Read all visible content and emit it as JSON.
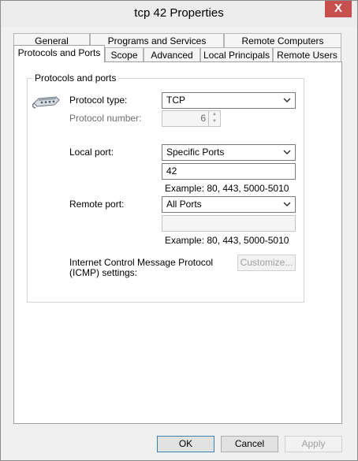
{
  "window": {
    "title": "tcp 42 Properties",
    "close_glyph": "X"
  },
  "tabs": {
    "row1": [
      "General",
      "Programs and Services",
      "Remote Computers"
    ],
    "row2": [
      "Protocols and Ports",
      "Scope",
      "Advanced",
      "Local Principals",
      "Remote Users"
    ]
  },
  "group": {
    "title": "Protocols and ports",
    "icon": "network-cable-icon"
  },
  "protocol_type": {
    "label": "Protocol type:",
    "value": "TCP"
  },
  "protocol_number": {
    "label": "Protocol number:",
    "value": "6"
  },
  "local_port": {
    "label": "Local port:",
    "value": "Specific Ports",
    "port_value": "42",
    "example": "Example: 80, 443, 5000-5010"
  },
  "remote_port": {
    "label": "Remote port:",
    "value": "All Ports",
    "port_value": "",
    "example": "Example: 80, 443, 5000-5010"
  },
  "icmp": {
    "label_line1": "Internet Control Message Protocol",
    "label_line2": "(ICMP) settings:",
    "button": "Customize..."
  },
  "buttons": {
    "ok": "OK",
    "cancel": "Cancel",
    "apply": "Apply"
  },
  "colors": {
    "close": "#c7504f",
    "default_border": "#3c7fb1"
  }
}
